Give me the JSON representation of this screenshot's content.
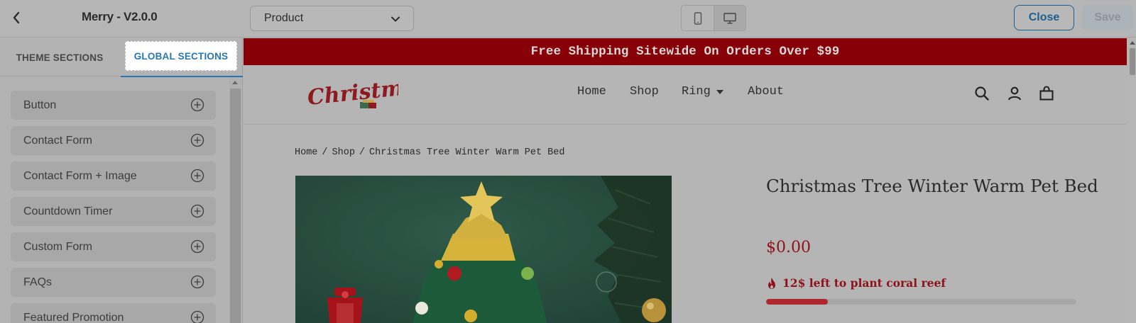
{
  "app": {
    "title": "Merry - V2.0.0"
  },
  "toolbar": {
    "page_selector_value": "Product",
    "close_label": "Close",
    "save_label": "Save",
    "device_modes": [
      "mobile-icon",
      "desktop-icon"
    ],
    "active_device": "desktop"
  },
  "sidebar": {
    "tabs": [
      {
        "label": "THEME SECTIONS",
        "active": false
      },
      {
        "label": "GLOBAL SECTIONS",
        "active": true
      }
    ],
    "sections": [
      {
        "label": "Button"
      },
      {
        "label": "Contact Form"
      },
      {
        "label": "Contact Form + Image"
      },
      {
        "label": "Countdown Timer"
      },
      {
        "label": "Custom Form"
      },
      {
        "label": "FAQs"
      },
      {
        "label": "Featured Promotion"
      }
    ]
  },
  "preview": {
    "announcement": "Free Shipping Sitewide On Orders Over $99",
    "logo_text": "Christmas",
    "nav": [
      {
        "label": "Home"
      },
      {
        "label": "Shop"
      },
      {
        "label": "Ring",
        "has_dropdown": true
      },
      {
        "label": "About"
      }
    ],
    "header_icons": [
      "search-icon",
      "account-icon",
      "cart-icon"
    ],
    "breadcrumb": [
      "Home",
      "Shop",
      "Christmas Tree Winter Warm Pet Bed"
    ],
    "product": {
      "title": "Christmas Tree Winter Warm Pet Bed",
      "price": "$0.00",
      "stock_message": "12$ left to plant coral reef",
      "stock_progress_percent": 20
    }
  },
  "colors": {
    "announcement_bg": "#880007",
    "price_red": "#8e1219",
    "accent_blue": "#2578b5"
  }
}
